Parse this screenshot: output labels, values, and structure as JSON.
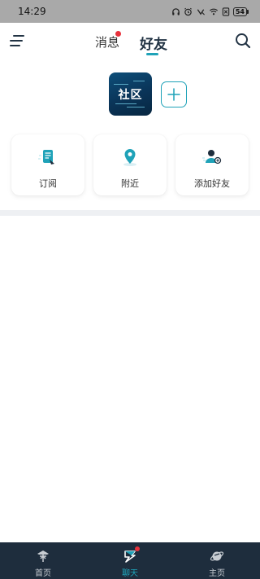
{
  "status_bar": {
    "time": "14:29",
    "battery": "54"
  },
  "header": {
    "tabs": [
      {
        "label": "消息",
        "has_badge": true
      },
      {
        "label": "好友",
        "active": true
      }
    ]
  },
  "community": {
    "logo_text": "社区"
  },
  "cards": [
    {
      "label": "订阅",
      "icon": "subscribe-icon"
    },
    {
      "label": "附近",
      "icon": "location-pin-icon"
    },
    {
      "label": "添加好友",
      "icon": "add-friend-icon"
    }
  ],
  "bottom_nav": {
    "items": [
      {
        "label": "首页",
        "icon": "home-icon"
      },
      {
        "label": "聊天",
        "icon": "chat-icon",
        "active": true,
        "has_badge": true
      },
      {
        "label": "主页",
        "icon": "profile-planet-icon"
      }
    ]
  },
  "colors": {
    "accent": "#1fa2b8",
    "badge": "#e8323c",
    "nav_bg": "#1e2d3d",
    "status_bg": "#a9a9a9"
  }
}
